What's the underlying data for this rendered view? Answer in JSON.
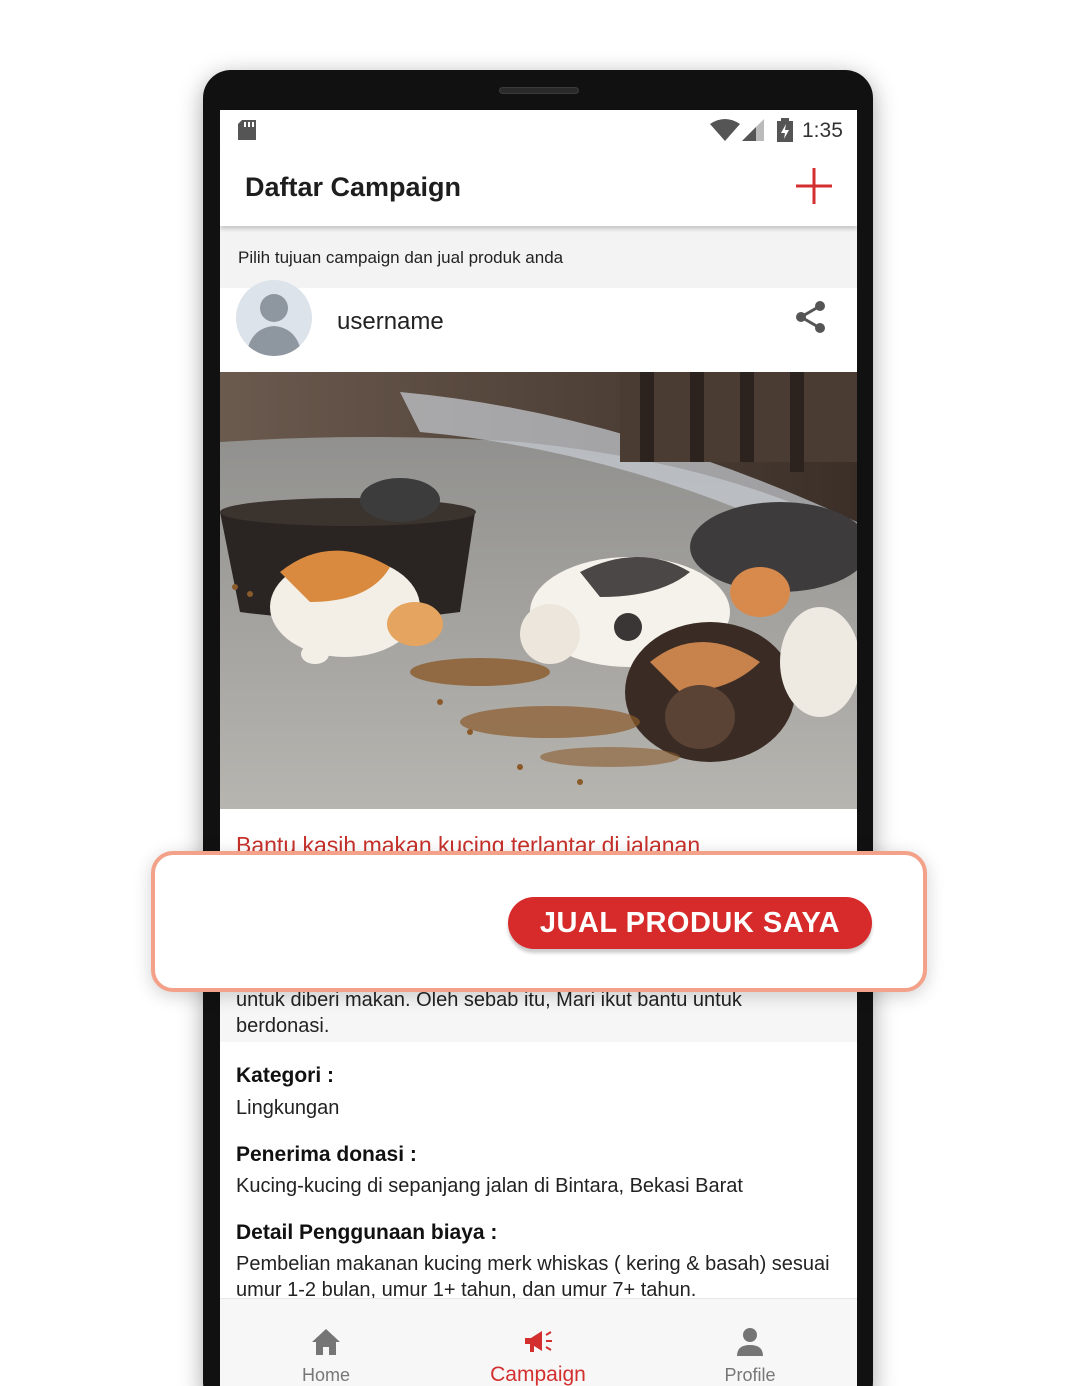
{
  "status_bar": {
    "time": "1:35"
  },
  "app_bar": {
    "title": "Daftar Campaign"
  },
  "subheader": "Pilih tujuan campaign dan jual produk anda",
  "post": {
    "username": "username",
    "campaign_title": "Bantu kasih makan kucing terlantar di jalanan",
    "description_lines": [
      "untuk diberi makan. Oleh sebab itu, Mari ikut bantu untuk",
      "berdonasi."
    ],
    "kategori_label": "Kategori :",
    "kategori_value": "Lingkungan",
    "penerima_label": "Penerima donasi :",
    "penerima_value": "Kucing-kucing di sepanjang jalan di Bintara, Bekasi Barat",
    "detail_label": "Detail Penggunaan biaya :",
    "detail_value": "Pembelian makanan kucing merk whiskas ( kering & basah) sesuai umur 1-2 bulan, umur 1+ tahun, dan umur 7+ tahun."
  },
  "overlay": {
    "button_label": "JUAL PRODUK SAYA"
  },
  "bottom_nav": {
    "items": [
      {
        "label": "Home",
        "icon": "home-icon",
        "active": false
      },
      {
        "label": "Campaign",
        "icon": "megaphone-icon",
        "active": true
      },
      {
        "label": "Profile",
        "icon": "person-icon",
        "active": false
      }
    ]
  },
  "colors": {
    "accent": "#d32f2f",
    "title_red": "#c8302a",
    "overlay_border": "#f3a189"
  }
}
